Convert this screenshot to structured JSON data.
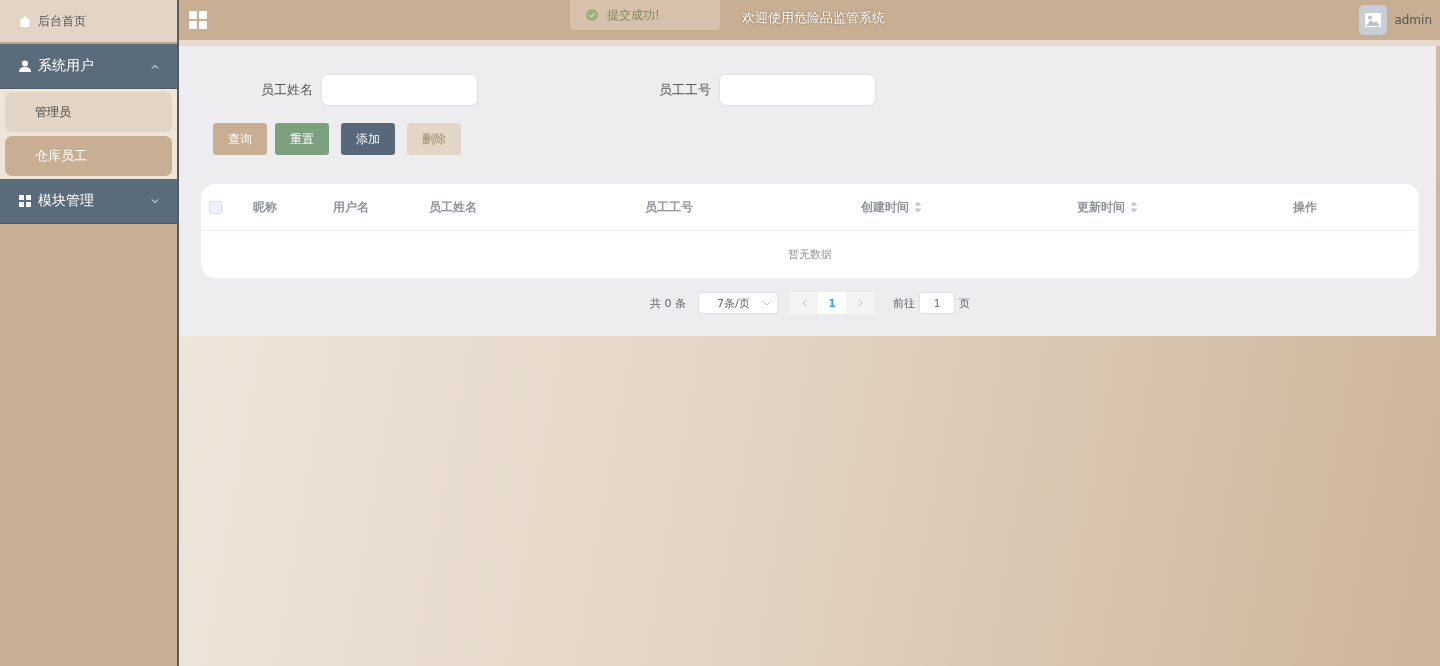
{
  "sidebar": {
    "home": {
      "label": "后台首页"
    },
    "groups": [
      {
        "label": "系统用户",
        "kind": "user",
        "expanded": true,
        "items": [
          {
            "label": "管理员",
            "selected": false
          },
          {
            "label": "仓库员工",
            "selected": true
          }
        ]
      },
      {
        "label": "模块管理",
        "kind": "grid",
        "expanded": false
      }
    ]
  },
  "header": {
    "title": "欢迎使用危险品监管系统",
    "user": "admin"
  },
  "toast": {
    "message": "提交成功!"
  },
  "search": {
    "fields": [
      {
        "label": "员工姓名"
      },
      {
        "label": "员工工号"
      }
    ],
    "buttons": [
      {
        "label": "查询",
        "kind": "query",
        "disabled": false
      },
      {
        "label": "重置",
        "kind": "reset",
        "disabled": false
      },
      {
        "label": "添加",
        "kind": "add",
        "disabled": false
      },
      {
        "label": "删除",
        "kind": "delete",
        "disabled": true
      }
    ]
  },
  "table": {
    "select_all": {
      "checked": false
    },
    "columns": [
      {
        "label": "昵称",
        "sortable": false
      },
      {
        "label": "用户名",
        "sortable": false
      },
      {
        "label": "员工姓名",
        "sortable": false
      },
      {
        "label": "员工工号",
        "sortable": false
      },
      {
        "label": "创建时间",
        "sortable": true
      },
      {
        "label": "更新时间",
        "sortable": true
      },
      {
        "label": "操作",
        "sortable": false
      }
    ],
    "empty_text": "暂无数据"
  },
  "pagination": {
    "total": "共 0 条",
    "page_size": "7条/页",
    "pages": [
      {
        "label": "1",
        "selected": true
      }
    ],
    "goto_label": "前往",
    "goto_value": "1",
    "goto_suffix": "页"
  }
}
